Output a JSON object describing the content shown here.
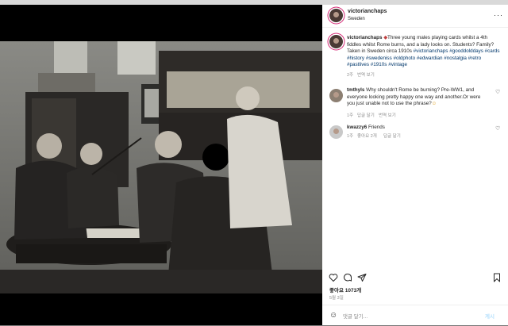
{
  "post": {
    "username": "victorianchaps",
    "location": "Sweden",
    "more_icon": "more-horizontal-icon",
    "caption": {
      "username": "victorianchaps",
      "text": "Three young males playing cards whilst a 4th fiddles whilst Rome burns, and a lady looks on. Students? Family? Taken in Sweden circa 1910s",
      "hashtags": [
        "#victorianchaps",
        "#gooddolddays",
        "#cards",
        "#history",
        "#swedeniss",
        "#oldphoto",
        "#edwardian",
        "#nostalgia",
        "#retro",
        "#pastlives",
        "#1910s",
        "#vintage"
      ],
      "age": "2주",
      "translate_label": "번역 보기"
    },
    "comments": [
      {
        "username": "tmthyls",
        "text": "Why shouldn't Rome be burning? Pre-WW1, and everyone looking pretty happy one way and another.Or were you just unable not to use the phrase?",
        "age": "1주",
        "reply_label": "답글 달기",
        "translate_label": "번역 보기"
      },
      {
        "username": "kwazzy6",
        "text": "Friends",
        "age": "1주",
        "likes_label": "좋아요 2개",
        "reply_label": "답글 달기"
      }
    ],
    "likes": "좋아요 1073개",
    "date": "5월 3일",
    "comment_placeholder": "댓글 달기...",
    "post_button": "게시"
  },
  "icons": {
    "like": "heart-icon",
    "comment": "comment-icon",
    "share": "send-icon",
    "save": "bookmark-icon",
    "emoji": "smiley-icon"
  },
  "colors": {
    "hashtag": "#00376b",
    "muted": "#8e8e8e",
    "text": "#262626",
    "post_disabled": "#b2dffc"
  }
}
